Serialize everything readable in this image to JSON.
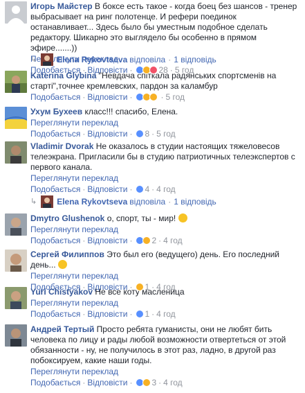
{
  "comments": [
    {
      "author": "Игорь Майстер",
      "text": "В боксе есть такое - когда боец без шансов - тренер выбрасывает на ринг полотенце. И рефери поединок останавливает... Здесь было бы уместным подобное сделать редактору. Шикарно это выглядело бы особенно в прямом эфире.......))",
      "translate": "Переглянути переклад",
      "like": "Подобається",
      "reply": "Відповісти",
      "reactions": [
        "like",
        "haha",
        "love"
      ],
      "count": "28",
      "time": "5 год"
    },
    {
      "author": "Katerina Glybina",
      "text": "\"Невдача спіткала радянських спортсменів на старті\",точнее кремлевских, пардон за каламбур",
      "like": "Подобається",
      "reply": "Відповісти",
      "reactions": [
        "like",
        "haha",
        "wow"
      ],
      "count": "",
      "time": "5 год"
    },
    {
      "author": "Ухум Бухеев",
      "text": "класс!!! спасибо, Елена.",
      "translate": "Переглянути переклад",
      "like": "Подобається",
      "reply": "Відповісти",
      "reactions": [
        "like"
      ],
      "count": "8",
      "time": "5 год"
    },
    {
      "author": "Vladimir Dvorak",
      "text": "Не оказалось в студии настоящих тяжеловесов телеэкрана. Пригласили бы в студию патриотичных телеэкспертов с первого канала.",
      "translate": "Переглянути переклад",
      "like": "Подобається",
      "reply": "Відповісти",
      "reactions": [
        "like"
      ],
      "count": "4",
      "time": "4 год"
    },
    {
      "author": "Dmytro Glushenok",
      "text": "о, спорт, ты - мир!",
      "translate": "Переглянути переклад",
      "like": "Подобається",
      "reply": "Відповісти",
      "reactions": [
        "like",
        "haha"
      ],
      "count": "2",
      "time": "4 год"
    },
    {
      "author": "Сергей Филиппов",
      "text": "Это был его (ведущего) день. Его последний день...",
      "translate": "Переглянути переклад",
      "like": "Подобається",
      "reply": "Відповісти",
      "reactions": [
        "haha"
      ],
      "count": "1",
      "time": "4 год"
    },
    {
      "author": "Yuri Chistyakov",
      "text": "Не все коту масленица",
      "translate": "Переглянути переклад",
      "like": "Подобається",
      "reply": "Відповісти",
      "reactions": [
        "like"
      ],
      "count": "1",
      "time": "4 год"
    },
    {
      "author": "Андрей Тертый",
      "text": "Просто ребята гуманисты, они не любят бить человека по лицу и рады любой возможности отвертеться от этой обязанности - ну, не получилось в этот раз, ладно, в другой раз побоксируем, какие наши годы.",
      "translate": "Переглянути переклад",
      "like": "Подобається",
      "reply": "Відповісти",
      "reactions": [
        "like",
        "haha"
      ],
      "count": "3",
      "time": "4 год"
    }
  ],
  "replies": [
    {
      "name": "Elena Rykovtseva",
      "verb": "відповіла",
      "count": "1 відповідь"
    },
    {
      "name": "Elena Rykovtseva",
      "verb": "відповіла",
      "count": "1 відповідь"
    }
  ],
  "colors": {
    "link": "#4267b2",
    "author": "#365899",
    "meta": "#90949c",
    "text": "#1d2129"
  }
}
